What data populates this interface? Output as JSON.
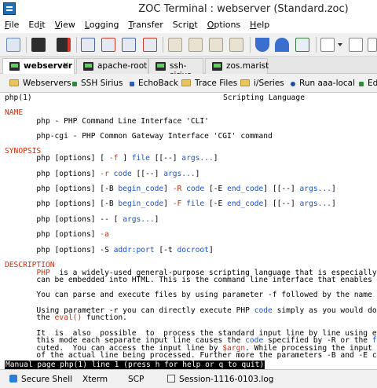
{
  "window": {
    "title": "ZOC Terminal : webserver (Standard.zoc)"
  },
  "menu": [
    {
      "pre": "",
      "u": "F",
      "post": "ile"
    },
    {
      "pre": "Ed",
      "u": "i",
      "post": "t"
    },
    {
      "pre": "",
      "u": "V",
      "post": "iew"
    },
    {
      "pre": "",
      "u": "L",
      "post": "ogging"
    },
    {
      "pre": "",
      "u": "T",
      "post": "ransfer"
    },
    {
      "pre": "Scri",
      "u": "p",
      "post": "t"
    },
    {
      "pre": "",
      "u": "O",
      "post": "ptions"
    },
    {
      "pre": "",
      "u": "H",
      "post": "elp"
    }
  ],
  "tabs": [
    {
      "label": "webserver",
      "close": "✕",
      "active": true
    },
    {
      "label": "apache-root",
      "active": false
    },
    {
      "label": "ssh-sirius",
      "active": false
    },
    {
      "label": "zos.marist",
      "active": false
    }
  ],
  "bookmarks": [
    {
      "label": "Webservers",
      "icon": "folder-icon"
    },
    {
      "label": "SSH Sirius",
      "icon": "host-icon"
    },
    {
      "label": "EchoBack",
      "icon": "host-icon"
    },
    {
      "label": "Trace Files",
      "icon": "folder-icon"
    },
    {
      "label": "i/Series",
      "icon": "folder-icon"
    },
    {
      "label": "Run aaa-local",
      "icon": "script-icon"
    },
    {
      "label": "Ed",
      "icon": "host-icon"
    }
  ],
  "terminal": {
    "header_left": "php(1)",
    "header_center": "Scripting Language",
    "name_heading": "NAME",
    "name_line1": "       php - PHP Command Line Interface 'CLI'",
    "name_line2": "       php-cgi - PHP Common Gateway Interface 'CGI' command",
    "synopsis_heading": "SYNOPSIS",
    "syn1": [
      {
        "t": "       php [options] [ ",
        "c": "blk"
      },
      {
        "t": "-f",
        "c": "red"
      },
      {
        "t": " ] ",
        "c": "blk"
      },
      {
        "t": "file",
        "c": "blue"
      },
      {
        "t": " [[--] ",
        "c": "blk"
      },
      {
        "t": "args...",
        "c": "blue"
      },
      {
        "t": "]",
        "c": "blk"
      }
    ],
    "syn2": [
      {
        "t": "       php [options] ",
        "c": "blk"
      },
      {
        "t": "-r",
        "c": "red"
      },
      {
        "t": " ",
        "c": "blk"
      },
      {
        "t": "code",
        "c": "blue"
      },
      {
        "t": " [[--] ",
        "c": "blk"
      },
      {
        "t": "args...",
        "c": "blue"
      },
      {
        "t": "]",
        "c": "blk"
      }
    ],
    "syn3": [
      {
        "t": "       php [options] [-B ",
        "c": "blk"
      },
      {
        "t": "begin_code",
        "c": "blue"
      },
      {
        "t": "] ",
        "c": "blk"
      },
      {
        "t": "-R",
        "c": "red"
      },
      {
        "t": " ",
        "c": "blk"
      },
      {
        "t": "code",
        "c": "blue"
      },
      {
        "t": " [-E ",
        "c": "blk"
      },
      {
        "t": "end_code",
        "c": "blue"
      },
      {
        "t": "] [[--] ",
        "c": "blk"
      },
      {
        "t": "args...",
        "c": "blue"
      },
      {
        "t": "]",
        "c": "blk"
      }
    ],
    "syn4": [
      {
        "t": "       php [options] [-B ",
        "c": "blk"
      },
      {
        "t": "begin_code",
        "c": "blue"
      },
      {
        "t": "] ",
        "c": "blk"
      },
      {
        "t": "-F",
        "c": "red"
      },
      {
        "t": " ",
        "c": "blk"
      },
      {
        "t": "file",
        "c": "blue"
      },
      {
        "t": " [-E ",
        "c": "blk"
      },
      {
        "t": "end_code",
        "c": "blue"
      },
      {
        "t": "] [[--] ",
        "c": "blk"
      },
      {
        "t": "args...",
        "c": "blue"
      },
      {
        "t": "]",
        "c": "blk"
      }
    ],
    "syn5": [
      {
        "t": "       php [options] -- [ ",
        "c": "blk"
      },
      {
        "t": "args...",
        "c": "blue"
      },
      {
        "t": "]",
        "c": "blk"
      }
    ],
    "syn6": [
      {
        "t": "       php [options] ",
        "c": "blk"
      },
      {
        "t": "-a",
        "c": "red"
      }
    ],
    "syn7": [
      {
        "t": "       php [options] -S ",
        "c": "blk"
      },
      {
        "t": "addr:port",
        "c": "blue"
      },
      {
        "t": " [-t ",
        "c": "blk"
      },
      {
        "t": "docroot",
        "c": "blue"
      },
      {
        "t": "]",
        "c": "blk"
      }
    ],
    "description_heading": "DESCRIPTION",
    "d1": [
      {
        "t": "       ",
        "c": "blk"
      },
      {
        "t": "PHP",
        "c": "red"
      },
      {
        "t": "  is a widely-used general-purpose scripting language that is especially",
        "c": "blk"
      }
    ],
    "d2": "       can be embedded into HTML. This is the command line interface that enables",
    "d3": "       You can parse and execute files by using parameter -f followed by the name",
    "d4": [
      {
        "t": "       Using parameter -r you can directly execute PHP ",
        "c": "blk"
      },
      {
        "t": "code",
        "c": "blue"
      },
      {
        "t": " simply as you would do",
        "c": "blk"
      }
    ],
    "d5": [
      {
        "t": "       the ",
        "c": "blk"
      },
      {
        "t": "eval()",
        "c": "red"
      },
      {
        "t": " function.",
        "c": "blk"
      }
    ],
    "d6": "       It  is  also  possible  to  process the standard input line by line using ei",
    "d7": [
      {
        "t": "       this mode each separate input line causes the ",
        "c": "blk"
      },
      {
        "t": "code",
        "c": "blue"
      },
      {
        "t": " specified by -R or the ",
        "c": "blk"
      },
      {
        "t": "f",
        "c": "blue"
      }
    ],
    "d8": [
      {
        "t": "       cuted.  You can access the input line by ",
        "c": "blk"
      },
      {
        "t": "$argn",
        "c": "red"
      },
      {
        "t": ". While processing the input",
        "c": "blk"
      }
    ],
    "d9": "       of the actual line being processed. Further more the parameters -B and -E c",
    "status_line": "Manual page php(1) line 1 (press h for help or q to quit)"
  },
  "statusbar": {
    "emulation_protocol": "Secure Shell",
    "terminal_type": "Xterm",
    "transfer": "SCP",
    "log_file": "Session-1116-0103.log"
  },
  "colors": {
    "accent": "#1c52c8",
    "keyword_red": "#d03010",
    "folder": "#e8c55a"
  }
}
